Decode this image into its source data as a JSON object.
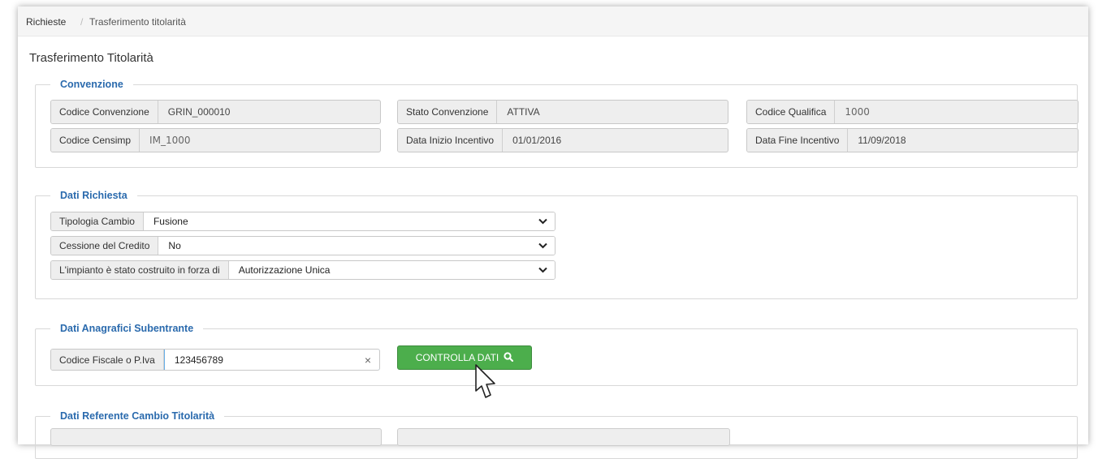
{
  "breadcrumb": {
    "items": [
      "Richieste",
      "Trasferimento titolarità"
    ],
    "separator": "/"
  },
  "page_title": "Trasferimento Titolarità",
  "convenzione": {
    "legend": "Convenzione",
    "fields": [
      {
        "label": "Codice Convenzione",
        "value": "GRIN_000010"
      },
      {
        "label": "Stato Convenzione",
        "value": "ATTIVA"
      },
      {
        "label": "Codice Qualifica",
        "value": "1000"
      },
      {
        "label": "Codice Censimp",
        "value": "IM_1000"
      },
      {
        "label": "Data Inizio Incentivo",
        "value": "01/01/2016"
      },
      {
        "label": "Data Fine Incentivo",
        "value": "11/09/2018"
      }
    ]
  },
  "dati_richiesta": {
    "legend": "Dati Richiesta",
    "selects": [
      {
        "label": "Tipologia Cambio",
        "value": "Fusione"
      },
      {
        "label": "Cessione del Credito",
        "value": "No"
      },
      {
        "label": "L'impianto è stato costruito in forza di",
        "value": "Autorizzazione Unica"
      }
    ]
  },
  "dati_anagrafici": {
    "legend": "Dati Anagrafici Subentrante",
    "input_label": "Codice Fiscale o P.Iva",
    "input_value": "123456789",
    "clear_symbol": "×",
    "button_label": "CONTROLLA DATI"
  },
  "dati_referente": {
    "legend": "Dati Referente Cambio Titolarità"
  },
  "colors": {
    "legend": "#2a6aad",
    "button": "#4cae4c"
  }
}
